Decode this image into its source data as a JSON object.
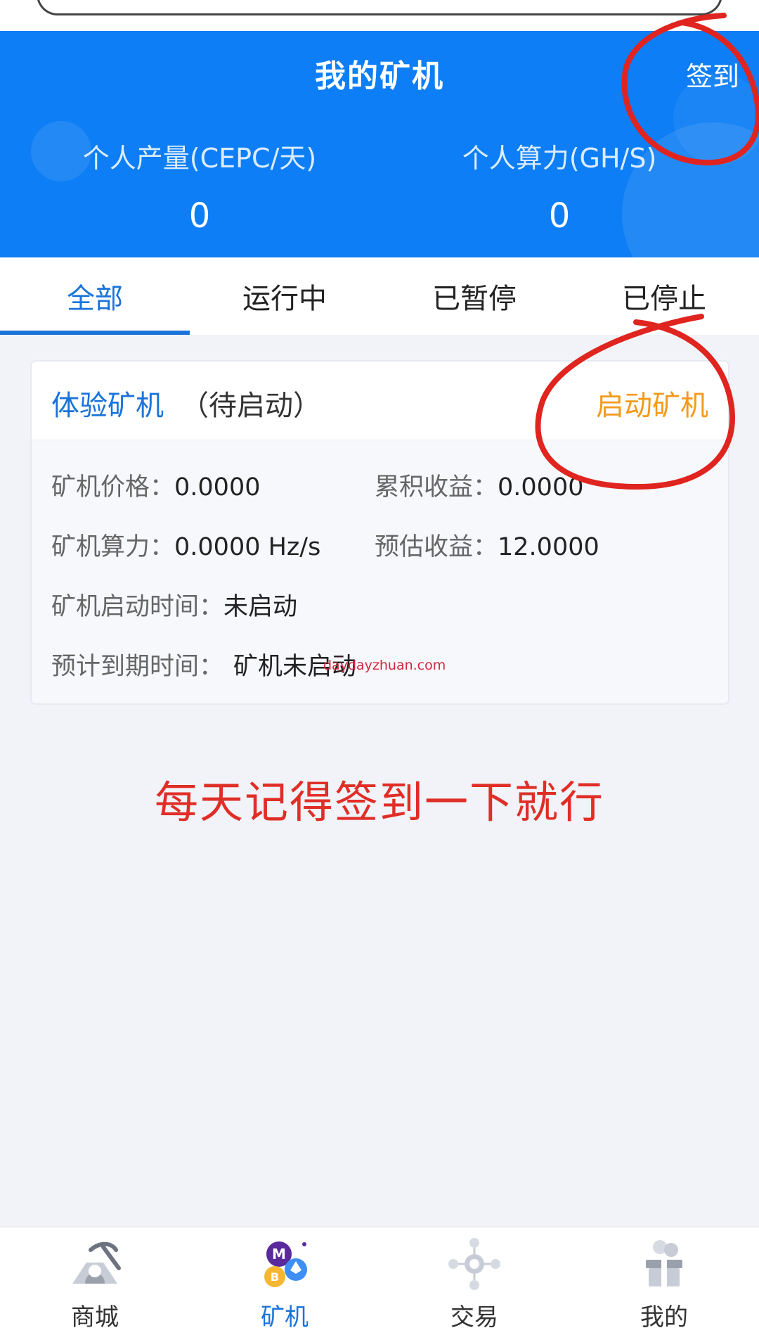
{
  "header": {
    "title": "我的矿机",
    "checkin_label": "签到",
    "stats": [
      {
        "label": "个人产量(CEPC/天)",
        "value": "0"
      },
      {
        "label": "个人算力(GH/S)",
        "value": "0"
      }
    ],
    "color": "#0d7ef5"
  },
  "tabs": [
    {
      "label": "全部",
      "active": true
    },
    {
      "label": "运行中",
      "active": false
    },
    {
      "label": "已暂停",
      "active": false
    },
    {
      "label": "已停止",
      "active": false
    }
  ],
  "card": {
    "name": "体验矿机",
    "status": "（待启动）",
    "action_label": "启动矿机",
    "fields": {
      "price": {
        "label": "矿机价格：",
        "value": "0.0000"
      },
      "accumulated": {
        "label": "累积收益：",
        "value": "0.0000"
      },
      "hashrate": {
        "label": "矿机算力：",
        "value": "0.0000 Hz/s"
      },
      "estimated": {
        "label": "预估收益：",
        "value": "12.0000"
      },
      "start_time": {
        "label": "矿机启动时间：",
        "value": "未启动"
      },
      "expire_time": {
        "label": "预计到期时间：",
        "value": "矿机未启动"
      }
    }
  },
  "watermark": "daydayzhuan.com",
  "annotation": "每天记得签到一下就行",
  "bottom_nav": [
    {
      "label": "商城",
      "icon": "mining-pick-icon",
      "active": false
    },
    {
      "label": "矿机",
      "icon": "crypto-coins-icon",
      "active": true
    },
    {
      "label": "交易",
      "icon": "exchange-network-icon",
      "active": false
    },
    {
      "label": "我的",
      "icon": "profile-gift-box-icon",
      "active": false
    }
  ],
  "colors": {
    "accent": "#1a73d9",
    "action": "#f39a1b",
    "annotation_red": "#e02e27"
  }
}
